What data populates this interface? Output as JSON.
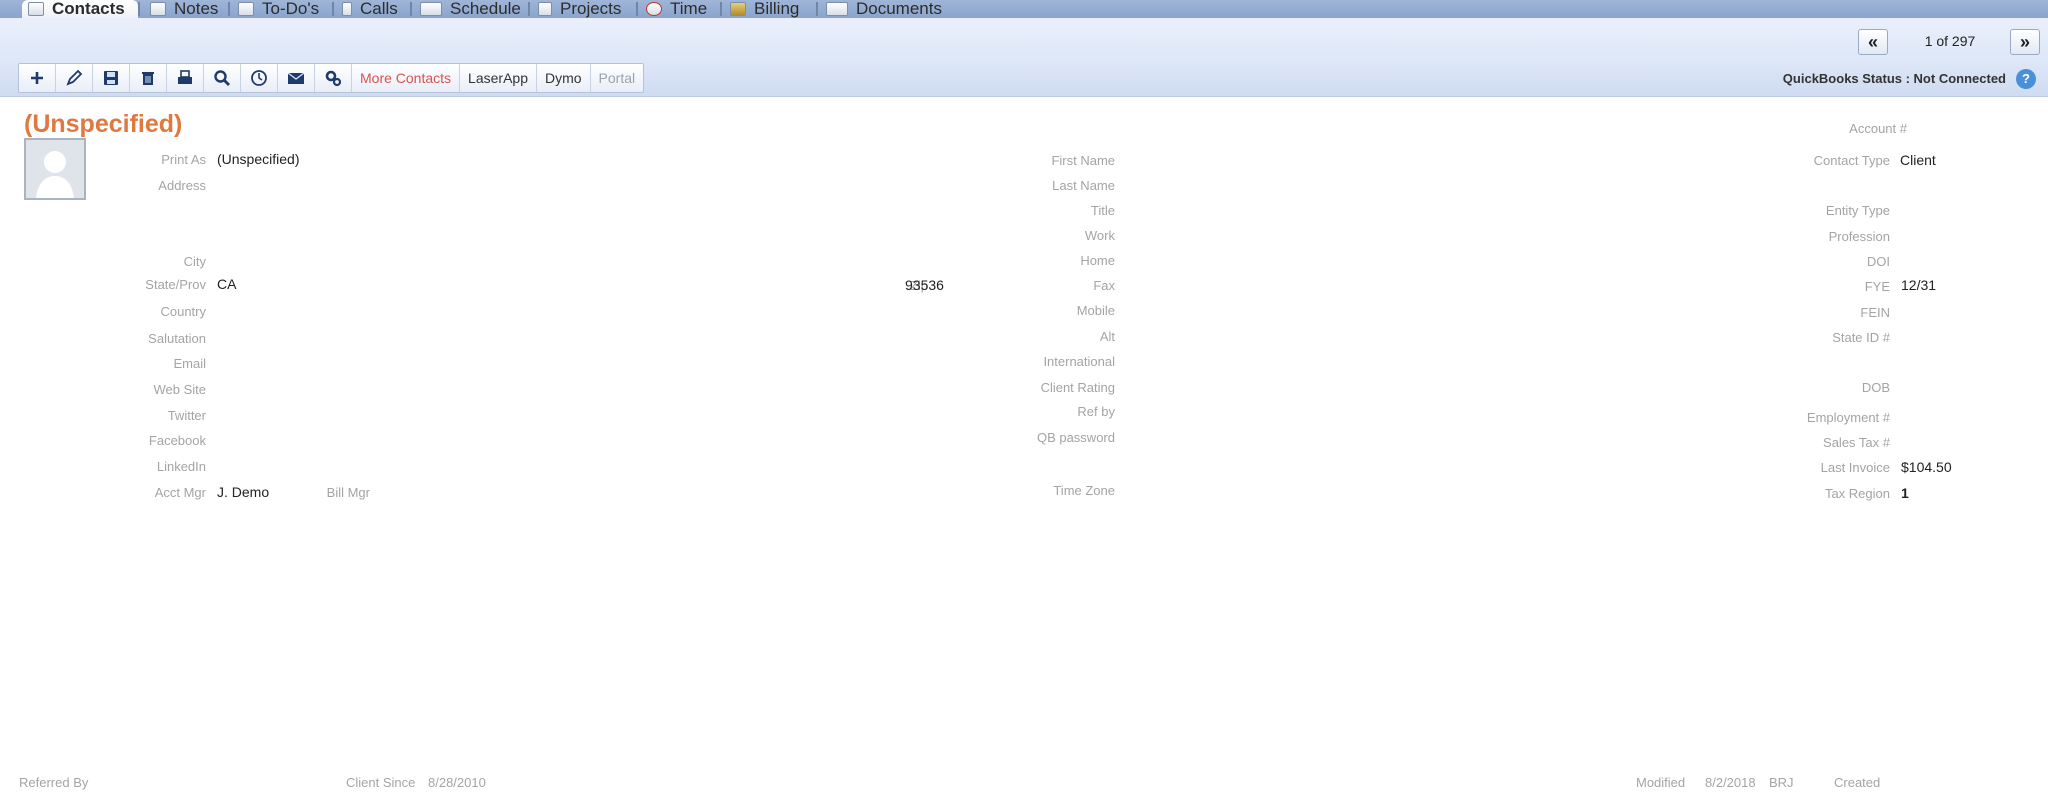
{
  "tabs": [
    {
      "label": "Contacts",
      "icon": "contacts-icon",
      "active": true
    },
    {
      "label": "Notes",
      "icon": "notes-icon"
    },
    {
      "label": "To-Do's",
      "icon": "todo-icon"
    },
    {
      "label": "Calls",
      "icon": "phone-icon"
    },
    {
      "label": "Schedule",
      "icon": "calendar-icon"
    },
    {
      "label": "Projects",
      "icon": "projects-icon"
    },
    {
      "label": "Time",
      "icon": "clock-icon"
    },
    {
      "label": "Billing",
      "icon": "billing-icon"
    },
    {
      "label": "Documents",
      "icon": "documents-icon"
    }
  ],
  "pager": {
    "prev": "«",
    "label": "1 of 297",
    "next": "»"
  },
  "toolbar": {
    "icons": [
      "add-icon",
      "edit-icon",
      "save-icon",
      "delete-icon",
      "print-icon",
      "search-icon",
      "history-icon",
      "email-icon",
      "settings-icon"
    ],
    "more_contacts": "More Contacts",
    "laserapp": "LaserApp",
    "dymo": "Dymo",
    "portal": "Portal"
  },
  "quickbooks": {
    "status": "QuickBooks Status : Not Connected",
    "help": "?"
  },
  "contact": {
    "title": "(Unspecified)",
    "left": {
      "print_as_label": "Print As",
      "print_as": "(Unspecified)",
      "address_label": "Address",
      "city_label": "City",
      "state_label": "State/Prov",
      "state": "CA",
      "zip_label": "Zip",
      "zip": "93536",
      "country_label": "Country",
      "salutation_label": "Salutation",
      "email_label": "Email",
      "website_label": "Web Site",
      "twitter_label": "Twitter",
      "facebook_label": "Facebook",
      "linkedin_label": "LinkedIn",
      "acct_mgr_label": "Acct Mgr",
      "acct_mgr": "J. Demo",
      "bill_mgr_label": "Bill Mgr"
    },
    "middle": {
      "first_name_label": "First Name",
      "last_name_label": "Last Name",
      "title_label": "Title",
      "work_label": "Work",
      "home_label": "Home",
      "fax_label": "Fax",
      "mobile_label": "Mobile",
      "alt_label": "Alt",
      "international_label": "International",
      "client_rating_label": "Client Rating",
      "ref_by_label": "Ref by",
      "qb_password_label": "QB password",
      "time_zone_label": "Time Zone"
    },
    "right": {
      "account_label": "Account #",
      "contact_type_label": "Contact Type",
      "contact_type": "Client",
      "entity_type_label": "Entity Type",
      "profession_label": "Profession",
      "doi_label": "DOI",
      "fye_label": "FYE",
      "fye": "12/31",
      "fein_label": "FEIN",
      "state_id_label": "State ID #",
      "dob_label": "DOB",
      "employment_label": "Employment #",
      "sales_tax_label": "Sales Tax #",
      "last_invoice_label": "Last Invoice",
      "last_invoice": "$104.50",
      "tax_region_label": "Tax Region",
      "tax_region": "1"
    }
  },
  "footer": {
    "referred_by_label": "Referred By",
    "client_since_label": "Client Since",
    "client_since": "8/28/2010",
    "modified_label": "Modified",
    "modified": "8/2/2018",
    "modified_by": "BRJ",
    "created_label": "Created"
  }
}
